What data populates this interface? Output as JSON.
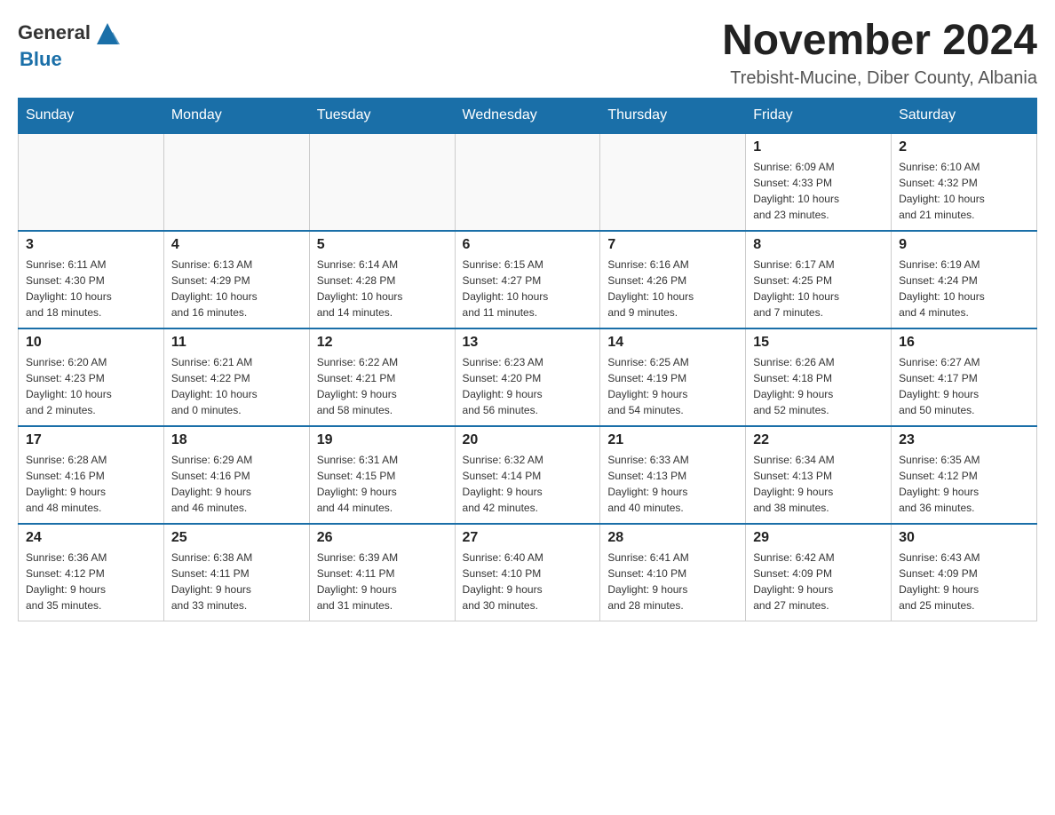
{
  "header": {
    "logo_general": "General",
    "logo_blue": "Blue",
    "month_year": "November 2024",
    "location": "Trebisht-Mucine, Diber County, Albania"
  },
  "weekdays": [
    "Sunday",
    "Monday",
    "Tuesday",
    "Wednesday",
    "Thursday",
    "Friday",
    "Saturday"
  ],
  "weeks": [
    [
      {
        "day": "",
        "info": ""
      },
      {
        "day": "",
        "info": ""
      },
      {
        "day": "",
        "info": ""
      },
      {
        "day": "",
        "info": ""
      },
      {
        "day": "",
        "info": ""
      },
      {
        "day": "1",
        "info": "Sunrise: 6:09 AM\nSunset: 4:33 PM\nDaylight: 10 hours\nand 23 minutes."
      },
      {
        "day": "2",
        "info": "Sunrise: 6:10 AM\nSunset: 4:32 PM\nDaylight: 10 hours\nand 21 minutes."
      }
    ],
    [
      {
        "day": "3",
        "info": "Sunrise: 6:11 AM\nSunset: 4:30 PM\nDaylight: 10 hours\nand 18 minutes."
      },
      {
        "day": "4",
        "info": "Sunrise: 6:13 AM\nSunset: 4:29 PM\nDaylight: 10 hours\nand 16 minutes."
      },
      {
        "day": "5",
        "info": "Sunrise: 6:14 AM\nSunset: 4:28 PM\nDaylight: 10 hours\nand 14 minutes."
      },
      {
        "day": "6",
        "info": "Sunrise: 6:15 AM\nSunset: 4:27 PM\nDaylight: 10 hours\nand 11 minutes."
      },
      {
        "day": "7",
        "info": "Sunrise: 6:16 AM\nSunset: 4:26 PM\nDaylight: 10 hours\nand 9 minutes."
      },
      {
        "day": "8",
        "info": "Sunrise: 6:17 AM\nSunset: 4:25 PM\nDaylight: 10 hours\nand 7 minutes."
      },
      {
        "day": "9",
        "info": "Sunrise: 6:19 AM\nSunset: 4:24 PM\nDaylight: 10 hours\nand 4 minutes."
      }
    ],
    [
      {
        "day": "10",
        "info": "Sunrise: 6:20 AM\nSunset: 4:23 PM\nDaylight: 10 hours\nand 2 minutes."
      },
      {
        "day": "11",
        "info": "Sunrise: 6:21 AM\nSunset: 4:22 PM\nDaylight: 10 hours\nand 0 minutes."
      },
      {
        "day": "12",
        "info": "Sunrise: 6:22 AM\nSunset: 4:21 PM\nDaylight: 9 hours\nand 58 minutes."
      },
      {
        "day": "13",
        "info": "Sunrise: 6:23 AM\nSunset: 4:20 PM\nDaylight: 9 hours\nand 56 minutes."
      },
      {
        "day": "14",
        "info": "Sunrise: 6:25 AM\nSunset: 4:19 PM\nDaylight: 9 hours\nand 54 minutes."
      },
      {
        "day": "15",
        "info": "Sunrise: 6:26 AM\nSunset: 4:18 PM\nDaylight: 9 hours\nand 52 minutes."
      },
      {
        "day": "16",
        "info": "Sunrise: 6:27 AM\nSunset: 4:17 PM\nDaylight: 9 hours\nand 50 minutes."
      }
    ],
    [
      {
        "day": "17",
        "info": "Sunrise: 6:28 AM\nSunset: 4:16 PM\nDaylight: 9 hours\nand 48 minutes."
      },
      {
        "day": "18",
        "info": "Sunrise: 6:29 AM\nSunset: 4:16 PM\nDaylight: 9 hours\nand 46 minutes."
      },
      {
        "day": "19",
        "info": "Sunrise: 6:31 AM\nSunset: 4:15 PM\nDaylight: 9 hours\nand 44 minutes."
      },
      {
        "day": "20",
        "info": "Sunrise: 6:32 AM\nSunset: 4:14 PM\nDaylight: 9 hours\nand 42 minutes."
      },
      {
        "day": "21",
        "info": "Sunrise: 6:33 AM\nSunset: 4:13 PM\nDaylight: 9 hours\nand 40 minutes."
      },
      {
        "day": "22",
        "info": "Sunrise: 6:34 AM\nSunset: 4:13 PM\nDaylight: 9 hours\nand 38 minutes."
      },
      {
        "day": "23",
        "info": "Sunrise: 6:35 AM\nSunset: 4:12 PM\nDaylight: 9 hours\nand 36 minutes."
      }
    ],
    [
      {
        "day": "24",
        "info": "Sunrise: 6:36 AM\nSunset: 4:12 PM\nDaylight: 9 hours\nand 35 minutes."
      },
      {
        "day": "25",
        "info": "Sunrise: 6:38 AM\nSunset: 4:11 PM\nDaylight: 9 hours\nand 33 minutes."
      },
      {
        "day": "26",
        "info": "Sunrise: 6:39 AM\nSunset: 4:11 PM\nDaylight: 9 hours\nand 31 minutes."
      },
      {
        "day": "27",
        "info": "Sunrise: 6:40 AM\nSunset: 4:10 PM\nDaylight: 9 hours\nand 30 minutes."
      },
      {
        "day": "28",
        "info": "Sunrise: 6:41 AM\nSunset: 4:10 PM\nDaylight: 9 hours\nand 28 minutes."
      },
      {
        "day": "29",
        "info": "Sunrise: 6:42 AM\nSunset: 4:09 PM\nDaylight: 9 hours\nand 27 minutes."
      },
      {
        "day": "30",
        "info": "Sunrise: 6:43 AM\nSunset: 4:09 PM\nDaylight: 9 hours\nand 25 minutes."
      }
    ]
  ]
}
